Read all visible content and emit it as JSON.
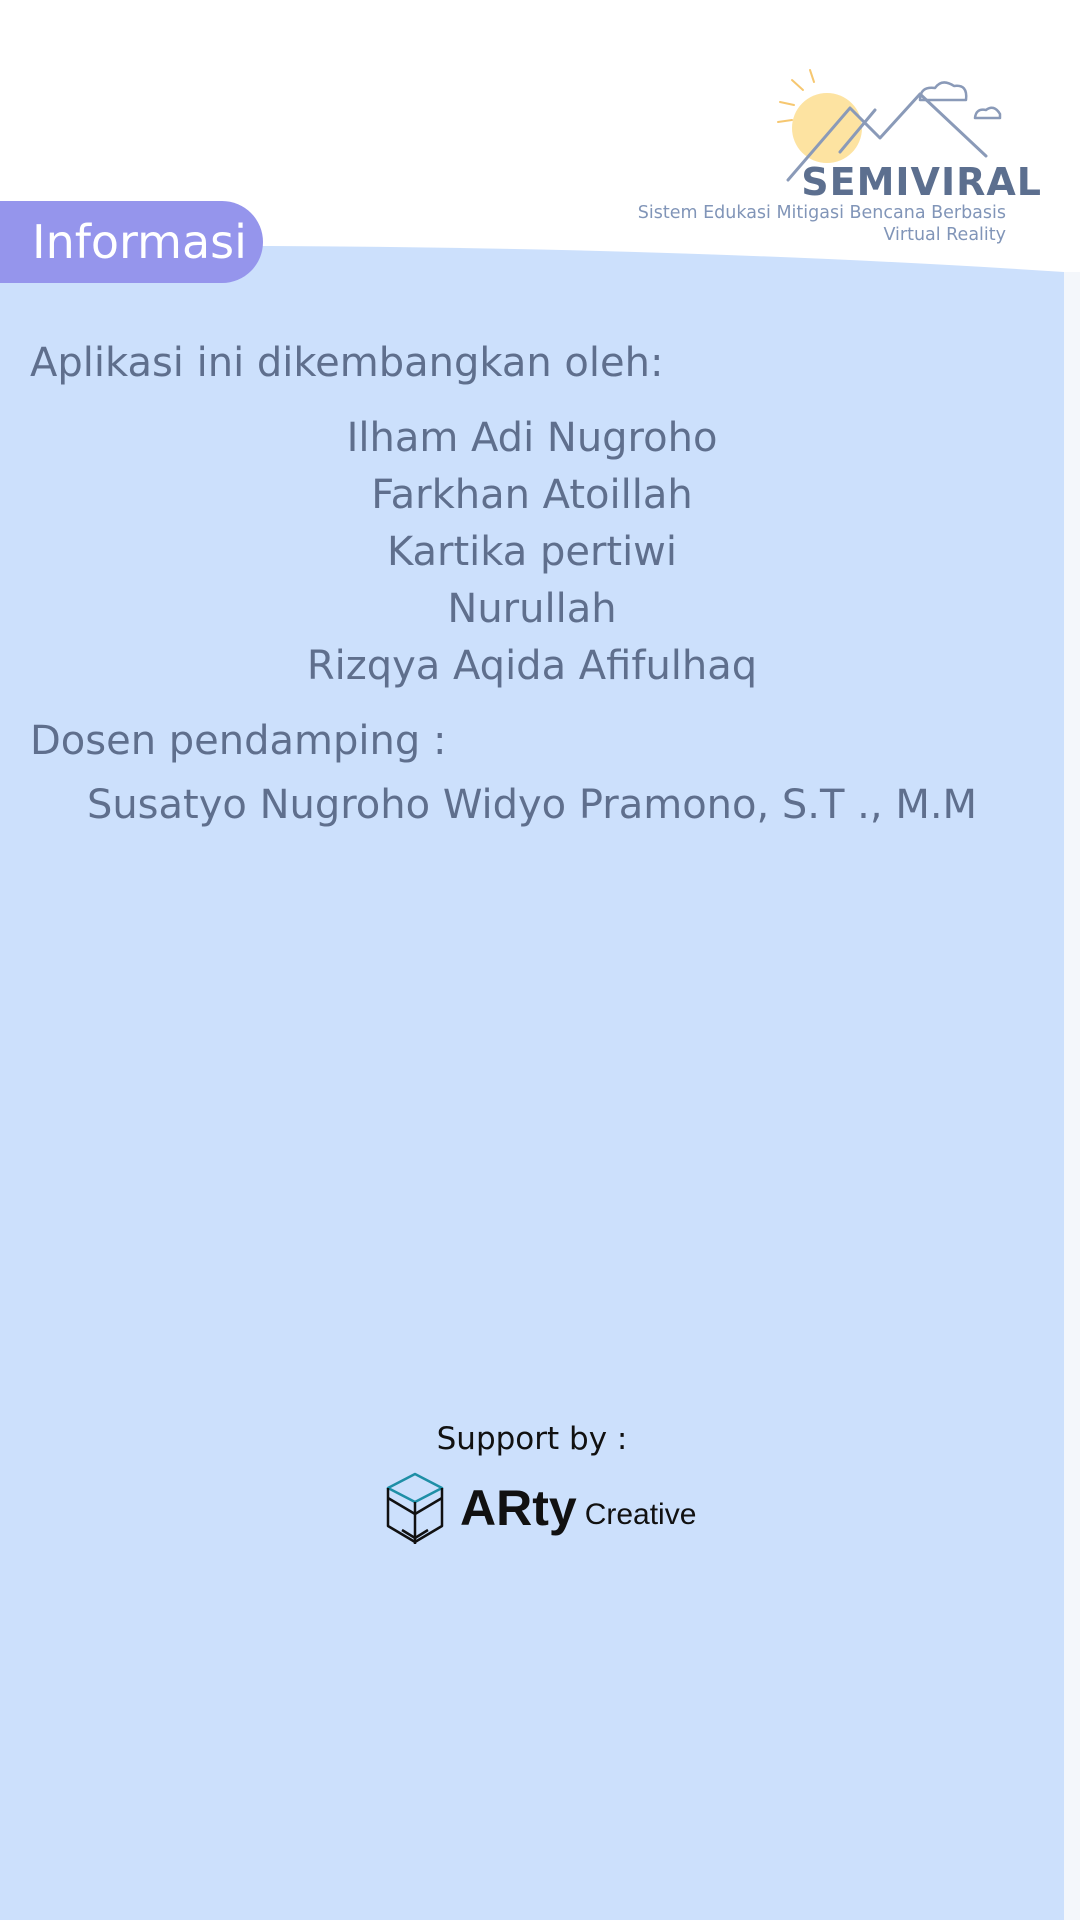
{
  "header": {
    "tab_label": "Informasi"
  },
  "logo": {
    "title": "SEMIVIRAL",
    "subtitle": "Sistem Edukasi Mitigasi Bencana Berbasis Virtual Reality"
  },
  "developers": {
    "heading": "Aplikasi ini dikembangkan oleh:",
    "names": [
      "Ilham Adi Nugroho",
      "Farkhan Atoillah",
      "Kartika pertiwi",
      "Nurullah",
      "Rizqya Aqida Afifulhaq"
    ]
  },
  "advisor": {
    "heading": "Dosen pendamping :",
    "name": "Susatyo Nugroho Widyo Pramono, S.T ., M.M"
  },
  "support": {
    "label": "Support by :",
    "brand_name": "ARty",
    "brand_suffix": "Creative"
  },
  "colors": {
    "panel": "#cce0fc",
    "pill": "#9595ec",
    "text": "#5f6f8d",
    "logo_sun": "#fde3a1",
    "logo_line": "#8a9ab8"
  }
}
